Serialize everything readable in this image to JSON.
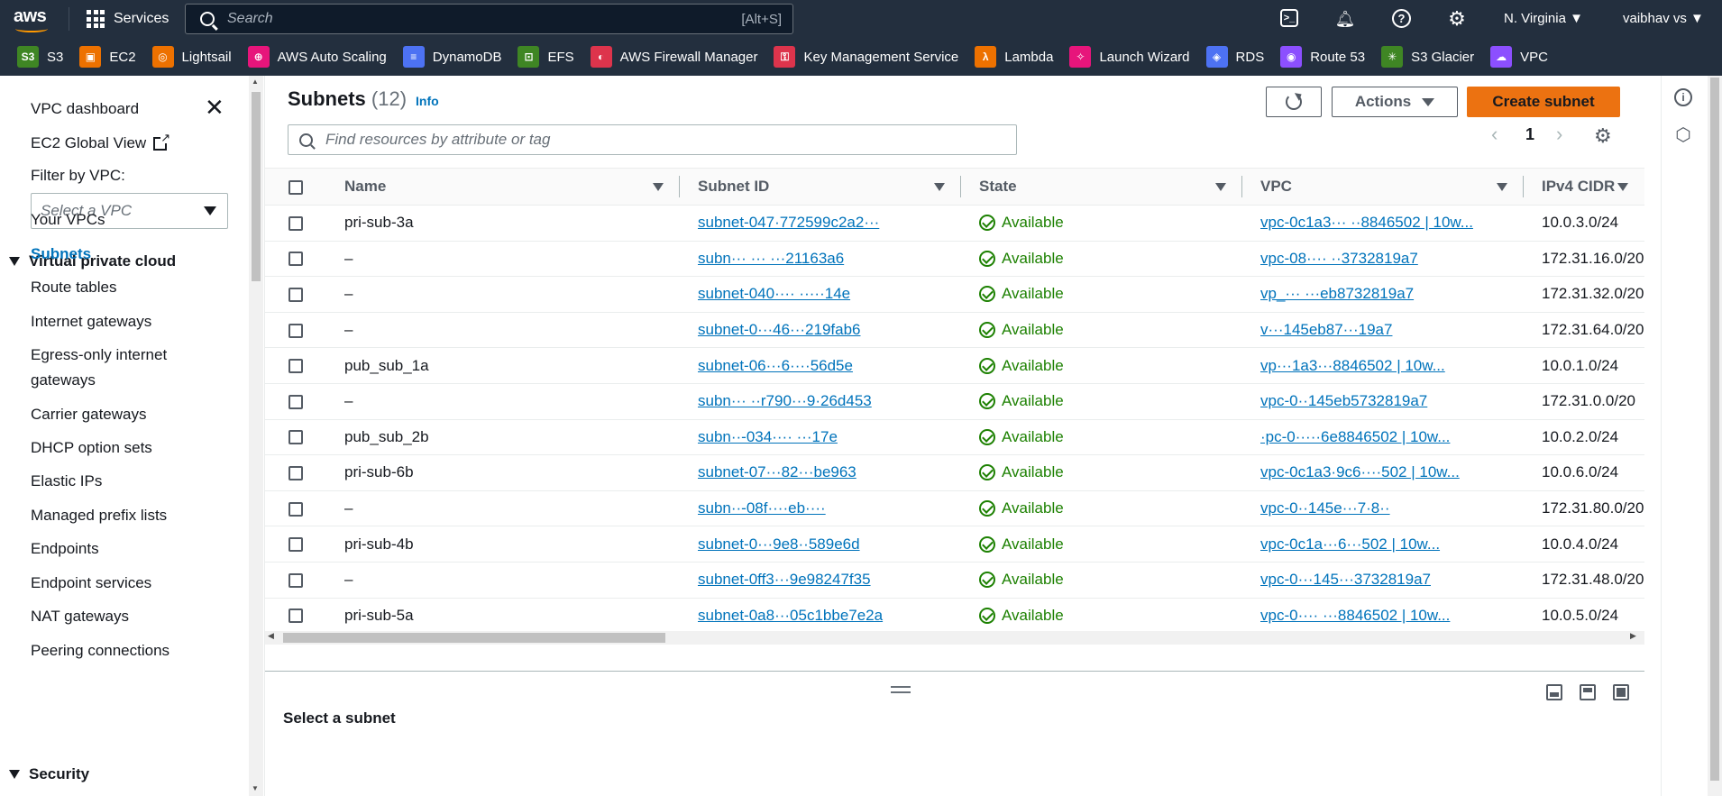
{
  "topnav": {
    "logo": "aws",
    "services_label": "Services",
    "search_placeholder": "Search",
    "search_shortcut": "[Alt+S]",
    "region": "N. Virginia ▼",
    "user": "vaibhav vs ▼"
  },
  "favorites": [
    {
      "label": "S3",
      "color": "#3f8624",
      "glyph": "S3"
    },
    {
      "label": "EC2",
      "color": "#ed7100",
      "glyph": "▣"
    },
    {
      "label": "Lightsail",
      "color": "#ed7100",
      "glyph": "◎"
    },
    {
      "label": "AWS Auto Scaling",
      "color": "#e7157b",
      "glyph": "⊕"
    },
    {
      "label": "DynamoDB",
      "color": "#4d72f3",
      "glyph": "≡"
    },
    {
      "label": "EFS",
      "color": "#3f8624",
      "glyph": "⊡"
    },
    {
      "label": "AWS Firewall Manager",
      "color": "#dd344c",
      "glyph": "◐"
    },
    {
      "label": "Key Management Service",
      "color": "#dd344c",
      "glyph": "⚿"
    },
    {
      "label": "Lambda",
      "color": "#ed7100",
      "glyph": "λ"
    },
    {
      "label": "Launch Wizard",
      "color": "#e7157b",
      "glyph": "✧"
    },
    {
      "label": "RDS",
      "color": "#4d72f3",
      "glyph": "◈"
    },
    {
      "label": "Route 53",
      "color": "#8c4fff",
      "glyph": "◉"
    },
    {
      "label": "S3 Glacier",
      "color": "#3f8624",
      "glyph": "✳"
    },
    {
      "label": "VPC",
      "color": "#8c4fff",
      "glyph": "☁"
    }
  ],
  "sidebar": {
    "dashboard": "VPC dashboard",
    "ec2_global": "EC2 Global View",
    "filter_label": "Filter by VPC:",
    "filter_placeholder": "Select a VPC",
    "section_vpc": "Virtual private cloud",
    "items": [
      {
        "label": "Your VPCs",
        "active": false
      },
      {
        "label": "Subnets",
        "active": true
      },
      {
        "label": "Route tables",
        "active": false
      },
      {
        "label": "Internet gateways",
        "active": false
      },
      {
        "label": "Egress-only internet",
        "active": false
      },
      {
        "label": "gateways",
        "active": false
      },
      {
        "label": "Carrier gateways",
        "active": false
      },
      {
        "label": "DHCP option sets",
        "active": false
      },
      {
        "label": "Elastic IPs",
        "active": false
      },
      {
        "label": "Managed prefix lists",
        "active": false
      },
      {
        "label": "Endpoints",
        "active": false
      },
      {
        "label": "Endpoint services",
        "active": false
      },
      {
        "label": "NAT gateways",
        "active": false
      },
      {
        "label": "Peering connections",
        "active": false
      }
    ],
    "section_security": "Security"
  },
  "main": {
    "title": "Subnets",
    "count": "(12)",
    "info": "Info",
    "actions_label": "Actions",
    "create_label": "Create subnet",
    "find_placeholder": "Find resources by attribute or tag",
    "page": "1"
  },
  "table": {
    "columns": [
      "Name",
      "Subnet ID",
      "State",
      "VPC",
      "IPv4 CIDR"
    ],
    "rows": [
      {
        "name": "pri-sub-3a",
        "subnet_id": "subnet-047·772599c2a2···",
        "state": "Available",
        "vpc": "vpc-0c1a3··· ··8846502 | 10w...",
        "cidr": "10.0.3.0/24"
      },
      {
        "name": "–",
        "subnet_id": "subn··· ··· ···21163a6",
        "state": "Available",
        "vpc": "vpc-08···· ··3732819a7",
        "cidr": "172.31.16.0/20"
      },
      {
        "name": "–",
        "subnet_id": "subnet-040···· ·····14e",
        "state": "Available",
        "vpc": "vp_··· ···eb8732819a7",
        "cidr": "172.31.32.0/20"
      },
      {
        "name": "–",
        "subnet_id": "subnet-0···46···219fab6",
        "state": "Available",
        "vpc": "v···145eb87···19a7",
        "cidr": "172.31.64.0/20"
      },
      {
        "name": "pub_sub_1a",
        "subnet_id": "subnet-06···6····56d5e",
        "state": "Available",
        "vpc": "vp···1a3···8846502 | 10w...",
        "cidr": "10.0.1.0/24"
      },
      {
        "name": "–",
        "subnet_id": "subn··· ··r790···9·26d453",
        "state": "Available",
        "vpc": "vpc-0··145eb5732819a7",
        "cidr": "172.31.0.0/20"
      },
      {
        "name": "pub_sub_2b",
        "subnet_id": "subn··-034···· ···17e",
        "state": "Available",
        "vpc": "·pc-0·····6e8846502 | 10w...",
        "cidr": "10.0.2.0/24"
      },
      {
        "name": "pri-sub-6b",
        "subnet_id": "subnet-07···82···be963",
        "state": "Available",
        "vpc": "vpc-0c1a3·9c6····502 | 10w...",
        "cidr": "10.0.6.0/24"
      },
      {
        "name": "–",
        "subnet_id": "subn··-08f····eb····",
        "state": "Available",
        "vpc": "vpc-0··145e···7·8··",
        "cidr": "172.31.80.0/20"
      },
      {
        "name": "pri-sub-4b",
        "subnet_id": "subnet-0···9e8··589e6d",
        "state": "Available",
        "vpc": "vpc-0c1a···6···502 | 10w...",
        "cidr": "10.0.4.0/24"
      },
      {
        "name": "–",
        "subnet_id": "subnet-0ff3···9e98247f35",
        "state": "Available",
        "vpc": "vpc-0···145···3732819a7",
        "cidr": "172.31.48.0/20"
      },
      {
        "name": "pri-sub-5a",
        "subnet_id": "subnet-0a8···05c1bbe7e2a",
        "state": "Available",
        "vpc": "vpc-0···· ···8846502 | 10w...",
        "cidr": "10.0.5.0/24"
      }
    ]
  },
  "split": {
    "title": "Select a subnet"
  },
  "colors": {
    "nav_bg": "#232f3e",
    "accent": "#ec7211",
    "link": "#0073bb",
    "success": "#1d8102"
  }
}
